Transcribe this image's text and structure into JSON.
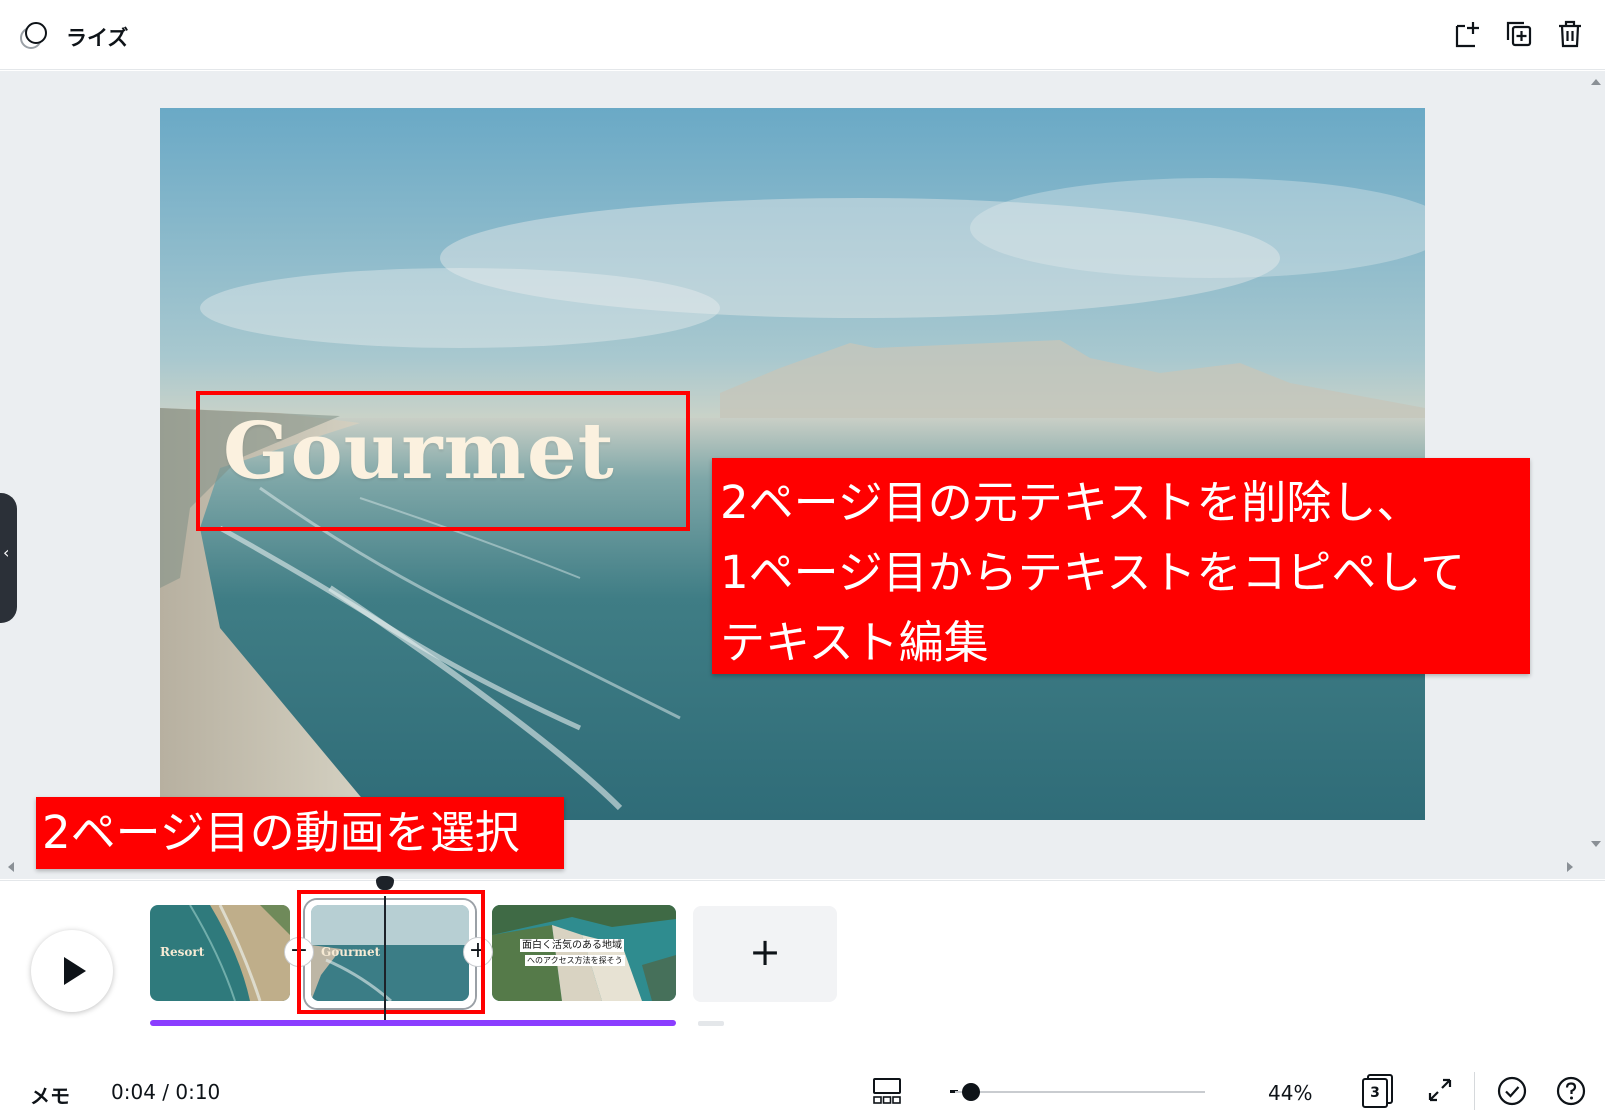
{
  "topbar": {
    "animate_label": "ライズ",
    "icons": [
      "add-page-icon",
      "duplicate-page-icon",
      "delete-icon"
    ]
  },
  "canvas": {
    "title_text": "Gourmet"
  },
  "annotations": {
    "edit_instruction_lines": [
      "2ページ目の元テキストを削除し、",
      "1ページ目からテキストをコピペして",
      "テキスト編集"
    ],
    "select_instruction": "2ページ目の動画を選択",
    "highlight_color": "#ff0000"
  },
  "timeline": {
    "clips": [
      {
        "label": "Resort"
      },
      {
        "label": "Gourmet"
      },
      {
        "label_lines": [
          "面白く活気のある地域",
          "へのアクセス方法を探そう"
        ]
      }
    ],
    "add_page_symbol": "+",
    "join_symbol": "+",
    "progress_color": "#8b3dff"
  },
  "footer": {
    "memo_label": "メモ",
    "time": "0:04 / 0:10",
    "zoom": "44%",
    "page_count": "3"
  }
}
